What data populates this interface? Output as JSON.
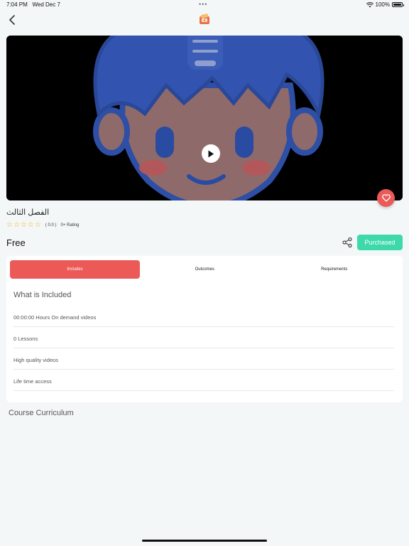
{
  "status": {
    "time": "7:04 PM",
    "date": "Wed Dec 7",
    "battery": "100%",
    "battery_level": 1.0
  },
  "nav": {
    "back_icon": "chevron-left-icon",
    "logo_icon": "app-logo-icon"
  },
  "video": {
    "play_icon": "play-icon",
    "favorite_icon": "heart-icon",
    "favorite_color": "#ec5a58"
  },
  "course": {
    "title": "الفصل الثالث",
    "stars": 0,
    "max_stars": 5,
    "score": "( 0.0 )",
    "rating_label": "0+ Rating",
    "price": "Free",
    "purchased_label": "Purchased",
    "accent_color": "#3dd9ab"
  },
  "tabs": [
    {
      "label": "Includes",
      "active": true
    },
    {
      "label": "Outcomes",
      "active": false
    },
    {
      "label": "Requirements",
      "active": false
    }
  ],
  "includes": {
    "title": "What is Included",
    "items": [
      "00:00:00 Hours On demand videos",
      "0 Lessons",
      "High quality videos",
      "Life time access"
    ]
  },
  "curriculum": {
    "title": "Course Curriculum"
  }
}
